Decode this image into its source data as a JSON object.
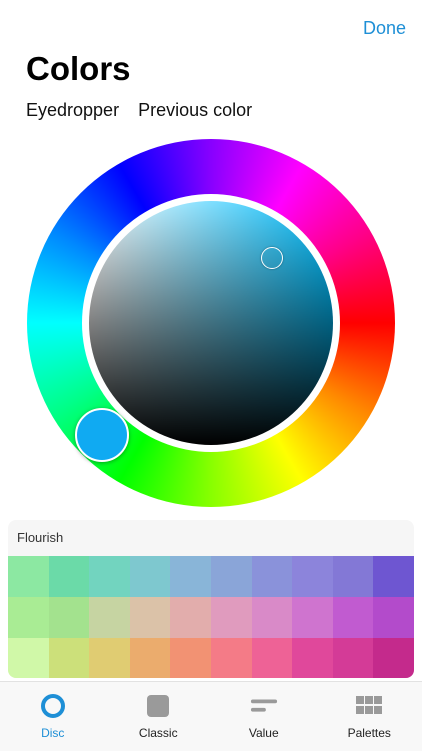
{
  "header": {
    "done_label": "Done",
    "title": "Colors",
    "tools": [
      {
        "label": "Eyedropper"
      },
      {
        "label": "Previous color"
      }
    ]
  },
  "picker": {
    "selected_color": "#10aaf2"
  },
  "palette": {
    "name": "Flourish",
    "swatches": [
      [
        "#8ce8a2",
        "#6bdaa8",
        "#72d4bf",
        "#7ec8cf",
        "#89b5d8",
        "#8aa5d8",
        "#8a92da",
        "#8c84db",
        "#8378d6",
        "#6e56d1"
      ],
      [
        "#a9ec94",
        "#a3e28e",
        "#c6d4a2",
        "#dbc2a8",
        "#e2adac",
        "#e09bbe",
        "#d98ac8",
        "#cf74cf",
        "#c15bd0",
        "#b34bcb"
      ],
      [
        "#d0f8a8",
        "#cce07a",
        "#e0cc72",
        "#ebac6d",
        "#f29273",
        "#f47b87",
        "#ee6296",
        "#e0489b",
        "#d43b97",
        "#c42a8c"
      ]
    ]
  },
  "tabs": [
    {
      "label": "Disc",
      "icon": "disc-icon",
      "active": true
    },
    {
      "label": "Classic",
      "icon": "square-icon",
      "active": false
    },
    {
      "label": "Value",
      "icon": "slider-lines-icon",
      "active": false
    },
    {
      "label": "Palettes",
      "icon": "grid-icon",
      "active": false
    }
  ],
  "colors": {
    "accent": "#1e8fd6"
  }
}
